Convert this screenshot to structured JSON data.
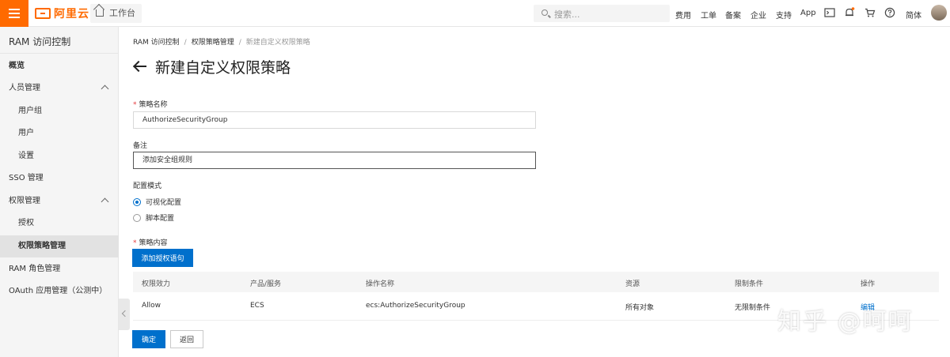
{
  "topbar": {
    "logo_text": "阿里云",
    "workbench_label": "工作台",
    "search_placeholder": "搜索...",
    "nav": [
      "费用",
      "工单",
      "备案",
      "企业",
      "支持",
      "App"
    ],
    "lang": "简体",
    "brand_color": "#ff6a00"
  },
  "sidebar": {
    "title": "RAM 访问控制",
    "items": [
      {
        "label": "概览"
      },
      {
        "label": "人员管理"
      },
      {
        "label": "用户组"
      },
      {
        "label": "用户"
      },
      {
        "label": "设置"
      },
      {
        "label": "SSO 管理"
      },
      {
        "label": "权限管理"
      },
      {
        "label": "授权"
      },
      {
        "label": "权限策略管理"
      },
      {
        "label": "RAM 角色管理"
      },
      {
        "label": "OAuth 应用管理（公测中）"
      }
    ]
  },
  "breadcrumb": [
    "RAM 访问控制",
    "权限策略管理",
    "新建自定义权限策略"
  ],
  "page_title": "新建自定义权限策略",
  "form": {
    "policy_name_label": "策略名称",
    "policy_name_value": "AuthorizeSecurityGroup",
    "note_label": "备注",
    "note_value": "添加安全组规则",
    "mode_label": "配置模式",
    "mode_options": [
      "可视化配置",
      "脚本配置"
    ],
    "mode_selected": "可视化配置",
    "content_label": "策略内容",
    "add_statement_button": "添加授权语句"
  },
  "table": {
    "headers": [
      "权限效力",
      "产品/服务",
      "操作名称",
      "资源",
      "限制条件",
      "操作"
    ],
    "rows": [
      {
        "effect": "Allow",
        "service": "ECS",
        "action": "ecs:AuthorizeSecurityGroup",
        "resource": "所有对象",
        "condition": "无限制条件",
        "op": "编辑"
      }
    ]
  },
  "footer": {
    "confirm": "确定",
    "back": "返回"
  },
  "watermark": "知乎 @呵呵",
  "accent_color": "#0070cc"
}
